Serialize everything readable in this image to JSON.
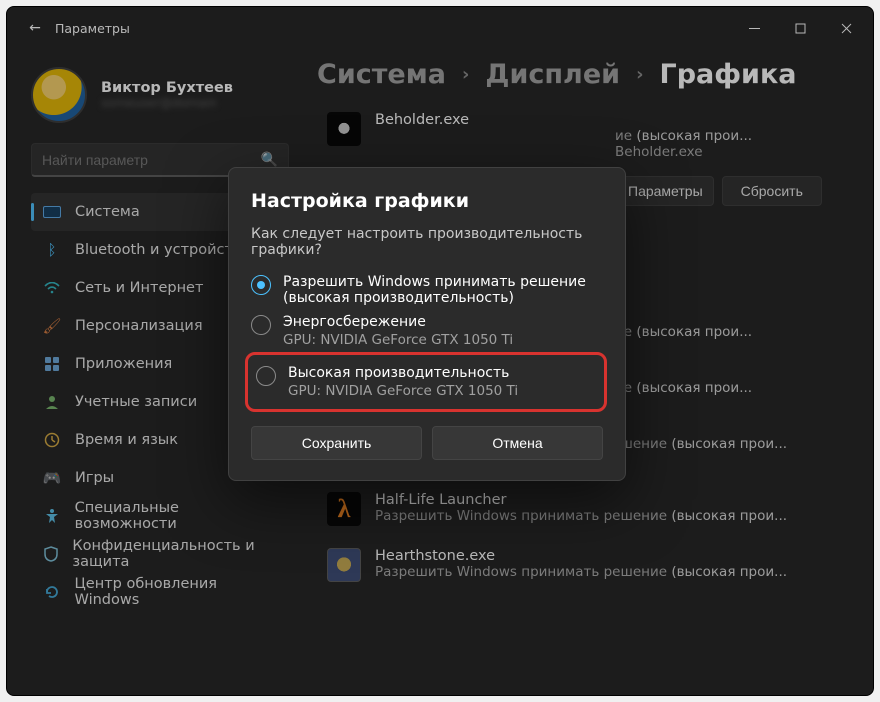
{
  "titlebar": {
    "back": "←",
    "title": "Параметры"
  },
  "profile": {
    "name": "Виктор Бухтеев",
    "sub": "someuser@domain"
  },
  "search": {
    "placeholder": "Найти параметр"
  },
  "nav": {
    "system": "Система",
    "bluetooth": "Bluetooth и устройства",
    "network": "Сеть и Интернет",
    "personalization": "Персонализация",
    "apps": "Приложения",
    "accounts": "Учетные записи",
    "time": "Время и язык",
    "gaming": "Игры",
    "accessibility": "Специальные возможности",
    "privacy": "Конфиденциальность и защита",
    "update": "Центр обновления Windows"
  },
  "breadcrumb": {
    "system": "Система",
    "display": "Дисплей",
    "graphics": "Графика"
  },
  "app_sub_prefix": "Разрешить Windows принимать решение ",
  "app_sub_hp": "(высокая прои...",
  "app_sub_beholder_line2": "Beholder.exe",
  "apps": {
    "beholder": "Beholder.exe",
    "hl": "Half-Life Launcher",
    "hs": "Hearthstone.exe"
  },
  "expanded": {
    "options_btn": "Параметры",
    "reset_btn": "Сбросить"
  },
  "dialog": {
    "title": "Настройка графики",
    "question": "Как следует настроить производительность графики?",
    "opt_let_windows": "Разрешить Windows принимать решение (высокая производительность)",
    "opt_power": "Энергосбережение",
    "opt_power_gpu": "GPU: NVIDIA GeForce GTX 1050 Ti",
    "opt_high": "Высокая производительность",
    "opt_high_gpu": "GPU: NVIDIA GeForce GTX 1050 Ti",
    "save": "Сохранить",
    "cancel": "Отмена"
  }
}
